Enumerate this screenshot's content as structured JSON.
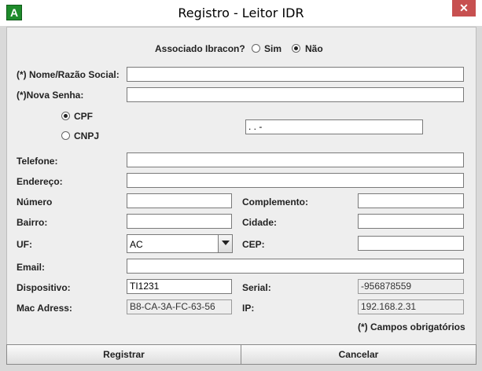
{
  "window": {
    "title": "Registro - Leitor IDR",
    "app_icon": "A",
    "close_label": "✕"
  },
  "associado": {
    "label": "Associado Ibracon?",
    "options": [
      "Sim",
      "Não"
    ],
    "selected": "Não"
  },
  "fields": {
    "nome_label": "(*) Nome/Razão Social:",
    "nome_value": "",
    "senha_label": "(*)Nova Senha:",
    "senha_value": "",
    "doc_type_options": [
      "CPF",
      "CNPJ"
    ],
    "doc_type_selected": "CPF",
    "doc_value": " .  .  -",
    "telefone_label": "Telefone:",
    "endereco_label": "Endereço:",
    "numero_label": "Número",
    "complemento_label": "Complemento:",
    "bairro_label": "Bairro:",
    "cidade_label": "Cidade:",
    "uf_label": "UF:",
    "uf_value": "AC",
    "cep_label": "CEP:",
    "email_label": "Email:",
    "dispositivo_label": "Dispositivo:",
    "dispositivo_value": "TI1231",
    "serial_label": "Serial:",
    "serial_value": "-956878559",
    "mac_label": "Mac Adress:",
    "mac_value": "B8-CA-3A-FC-63-56",
    "ip_label": "IP:",
    "ip_value": "192.168.2.31"
  },
  "footer": {
    "required_note": "(*) Campos obrigatórios"
  },
  "buttons": {
    "register": "Registrar",
    "cancel": "Cancelar"
  },
  "colors": {
    "accent_close": "#c75050",
    "app_icon_bg": "#1e8b2b",
    "panel_bg": "#eeeeee"
  }
}
